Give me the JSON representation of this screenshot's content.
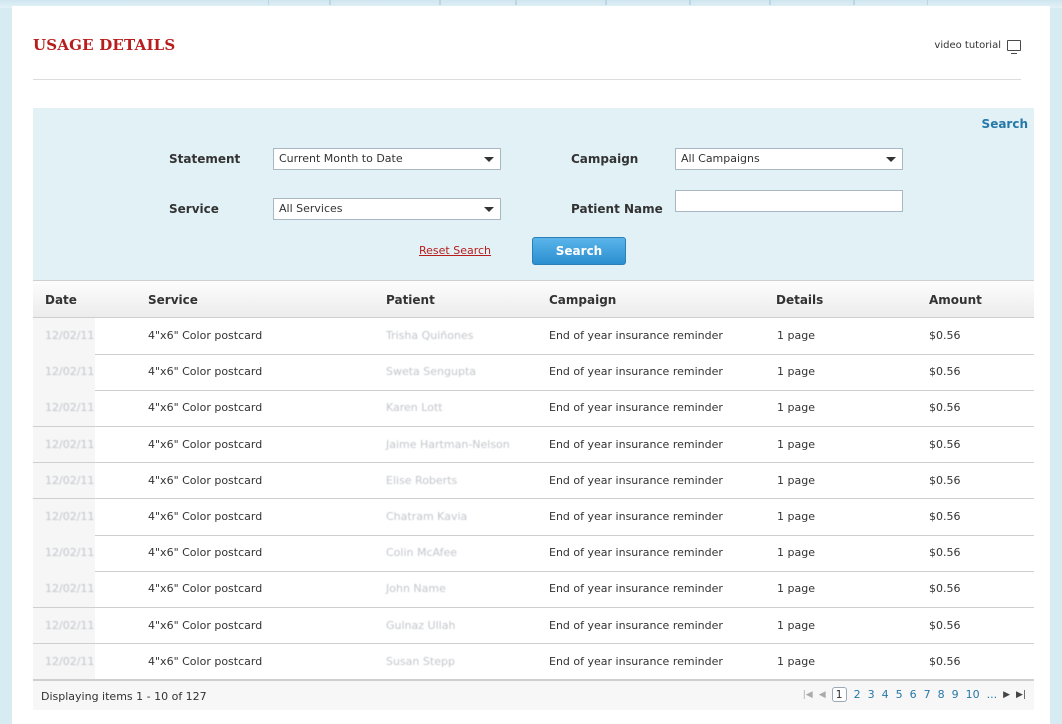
{
  "page": {
    "title": "USAGE DETAILS",
    "video_tutorial_label": "video tutorial"
  },
  "search": {
    "heading": "Search",
    "statement": {
      "label": "Statement",
      "value": "Current Month to Date"
    },
    "campaign": {
      "label": "Campaign",
      "value": "All Campaigns"
    },
    "service": {
      "label": "Service",
      "value": "All Services"
    },
    "patient_name": {
      "label": "Patient Name",
      "value": ""
    },
    "reset_label": "Reset Search",
    "search_button": "Search"
  },
  "table": {
    "columns": [
      "Date",
      "Service",
      "Patient",
      "Campaign",
      "Details",
      "Amount"
    ],
    "rows": [
      [
        "12/02/11",
        "4\"x6\" Color postcard",
        "Trisha Quiñones",
        "End of year insurance reminder",
        "1 page",
        "$0.56"
      ],
      [
        "12/02/11",
        "4\"x6\" Color postcard",
        "Sweta Sengupta",
        "End of year insurance reminder",
        "1 page",
        "$0.56"
      ],
      [
        "12/02/11",
        "4\"x6\" Color postcard",
        "Karen Lott",
        "End of year insurance reminder",
        "1 page",
        "$0.56"
      ],
      [
        "12/02/11",
        "4\"x6\" Color postcard",
        "Jaime Hartman-Nelson",
        "End of year insurance reminder",
        "1 page",
        "$0.56"
      ],
      [
        "12/02/11",
        "4\"x6\" Color postcard",
        "Elise Roberts",
        "End of year insurance reminder",
        "1 page",
        "$0.56"
      ],
      [
        "12/02/11",
        "4\"x6\" Color postcard",
        "Chatram Kavia",
        "End of year insurance reminder",
        "1 page",
        "$0.56"
      ],
      [
        "12/02/11",
        "4\"x6\" Color postcard",
        "Colin McAfee",
        "End of year insurance reminder",
        "1 page",
        "$0.56"
      ],
      [
        "12/02/11",
        "4\"x6\" Color postcard",
        "John Name",
        "End of year insurance reminder",
        "1 page",
        "$0.56"
      ],
      [
        "12/02/11",
        "4\"x6\" Color postcard",
        "Gulnaz Ullah",
        "End of year insurance reminder",
        "1 page",
        "$0.56"
      ],
      [
        "12/02/11",
        "4\"x6\" Color postcard",
        "Susan Stepp",
        "End of year insurance reminder",
        "1 page",
        "$0.56"
      ]
    ]
  },
  "pager": {
    "info": "Displaying items 1 - 10 of 127",
    "pages": [
      "1",
      "2",
      "3",
      "4",
      "5",
      "6",
      "7",
      "8",
      "9",
      "10",
      "..."
    ],
    "current_page": "1",
    "first_glyph": "|◀",
    "prev_glyph": "◀",
    "next_glyph": "▶",
    "last_glyph": "▶|"
  },
  "colors": {
    "title_red": "#b81d1d",
    "link_blue": "#2678a8",
    "search_panel_bg": "#e1f1f6",
    "button_blue": "#2b8fcf"
  }
}
